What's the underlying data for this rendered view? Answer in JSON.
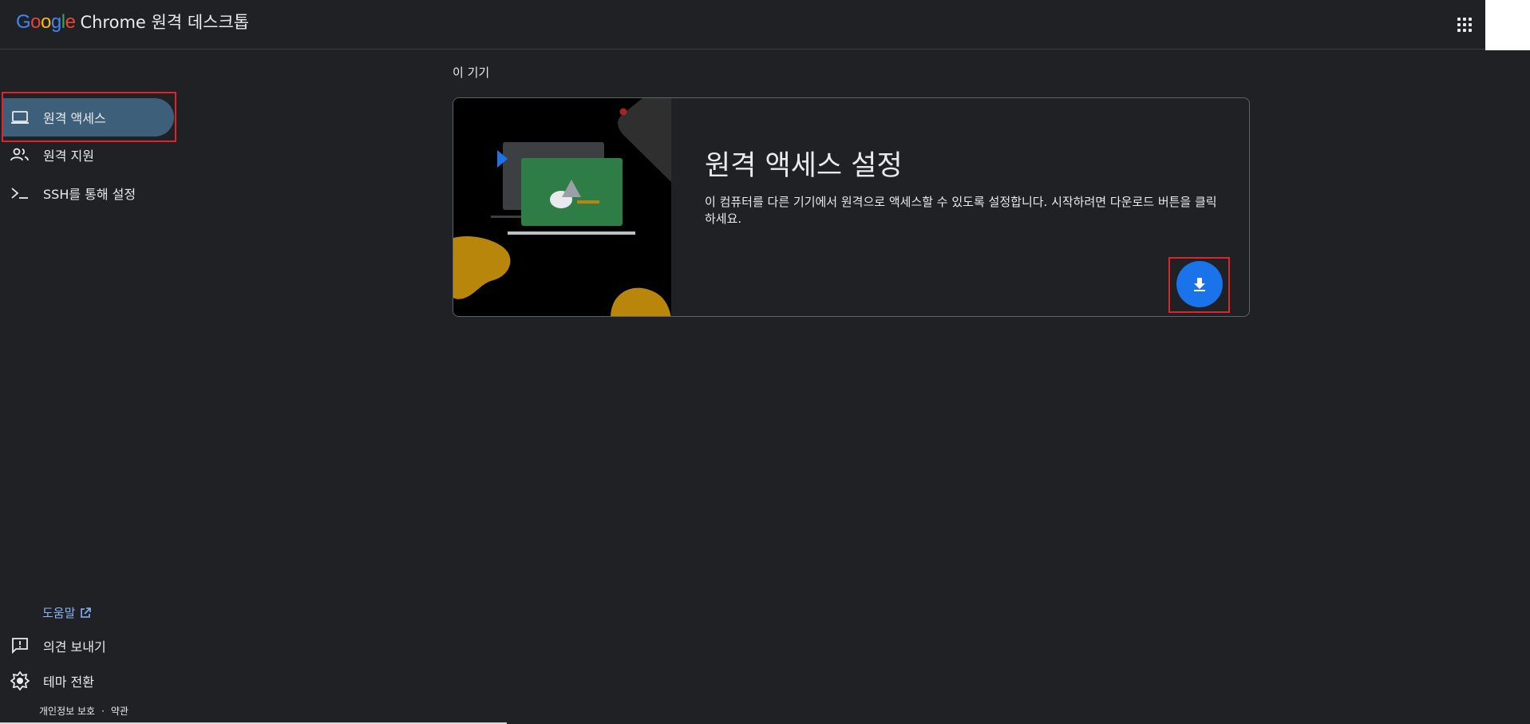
{
  "header": {
    "logo_letters": [
      "G",
      "o",
      "o",
      "g",
      "l",
      "e"
    ],
    "product_name": "Chrome 원격 데스크톱",
    "apps_icon": "apps-grid-icon"
  },
  "sidebar": {
    "items": [
      {
        "label": "원격 액세스",
        "icon": "laptop-icon",
        "active": true
      },
      {
        "label": "원격 지원",
        "icon": "people-icon",
        "active": false
      },
      {
        "label": "SSH를 통해 설정",
        "icon": "terminal-icon",
        "active": false
      }
    ],
    "help_label": "도움말",
    "feedback_label": "의견 보내기",
    "theme_label": "테마 전환",
    "privacy_label": "개인정보 보호",
    "separator": "·",
    "terms_label": "약관"
  },
  "main": {
    "section_label": "이 기기",
    "card": {
      "title": "원격 액세스 설정",
      "description": "이 컴퓨터를 다른 기기에서 원격으로 액세스할 수 있도록 설정합니다. 시작하려면 다운로드 버튼을 클릭하세요.",
      "button_icon": "download-icon"
    }
  },
  "colors": {
    "background": "#202124",
    "active_nav": "#3e5f7a",
    "accent_blue": "#1a73e8",
    "link_blue": "#8ab4f8",
    "highlight_red": "#e0242b",
    "illus_green": "#2e7d46",
    "illus_gold": "#b8860b"
  }
}
